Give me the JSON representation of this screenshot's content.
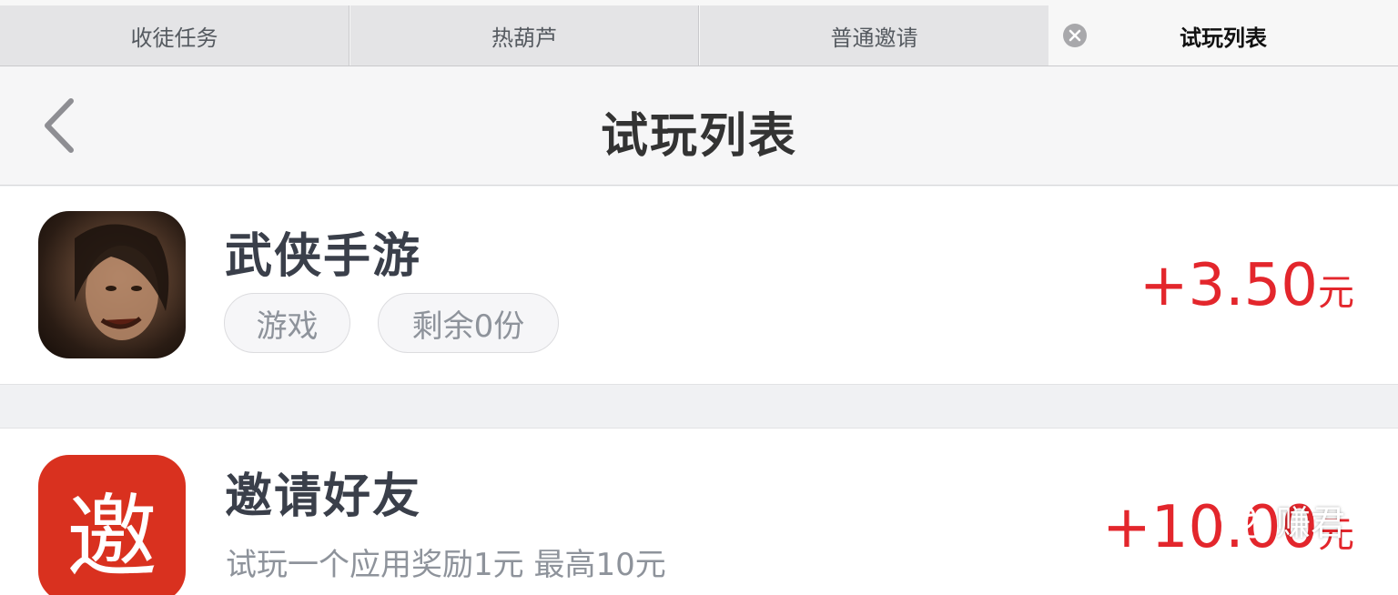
{
  "tabs": [
    {
      "label": "收徒任务"
    },
    {
      "label": "热葫芦"
    },
    {
      "label": "普通邀请"
    },
    {
      "label": "试玩列表"
    }
  ],
  "nav": {
    "title": "试玩列表"
  },
  "items": [
    {
      "name": "武侠手游",
      "tags": [
        "游戏",
        "剩余0份"
      ],
      "reward": "+3.50",
      "reward_unit": "元",
      "icon": "game-hero-portrait"
    },
    {
      "name": "邀请好友",
      "description": "试玩一个应用奖励1元 最高10元",
      "reward": "+10.00",
      "reward_unit": "元",
      "icon_text": "邀"
    }
  ],
  "watermark": {
    "text": "赚君"
  },
  "colors": {
    "reward": "#e3262c",
    "invite_icon_bg": "#d9311f",
    "tab_inactive_bg": "#e4e4e6"
  }
}
